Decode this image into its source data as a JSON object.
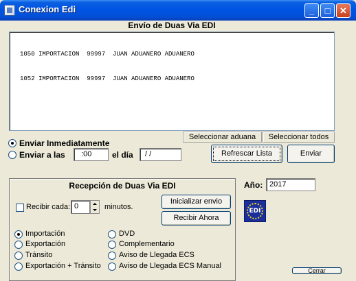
{
  "window": {
    "title": "Conexion Edi"
  },
  "titlebar_buttons": {
    "minimize": "_",
    "maximize": "□",
    "close": "✕"
  },
  "envio": {
    "title": "Envío de Duas Via EDI",
    "rows": [
      "1050 IMPORTACION  99997  JUAN ADUANERO ADUANERO",
      "1052 IMPORTACION  99997  JUAN ADUANERO ADUANERO"
    ],
    "btn_select_aduana": "Seleccionar aduana",
    "btn_select_todos": "Seleccionar todos",
    "radio_inmediatamente": "Enviar Inmediatamente",
    "radio_enviar_a_las": "Enviar a las",
    "time_value": "  :00",
    "el_dia_label": "el día",
    "date_value": " / /",
    "btn_refrescar": "Refrescar Lista",
    "btn_enviar": "Enviar"
  },
  "recepcion": {
    "title": "Recepción de Duas Via EDI",
    "recibir_cada_label": "Recibir cada:",
    "recibir_value": "0",
    "minutos_label": "minutos.",
    "btn_inicializar": "Inicializar envio",
    "btn_recibir_ahora": "Recibir Ahora",
    "options_left": [
      "Importación",
      "Exportación",
      "Tránsito",
      "Exportación + Tránsito"
    ],
    "options_right": [
      "DVD",
      "Complementario",
      "Aviso de Llegada ECS",
      "Aviso de Llegada ECS Manual"
    ]
  },
  "anio": {
    "label": "Año:",
    "value": "2017"
  },
  "logo_text": "EDI",
  "bottom_button": "Cerrar",
  "colors": {
    "titlebar": "#0054e3",
    "dialog_bg": "#ece9d8",
    "logo_bg": "#1a2f9c"
  }
}
